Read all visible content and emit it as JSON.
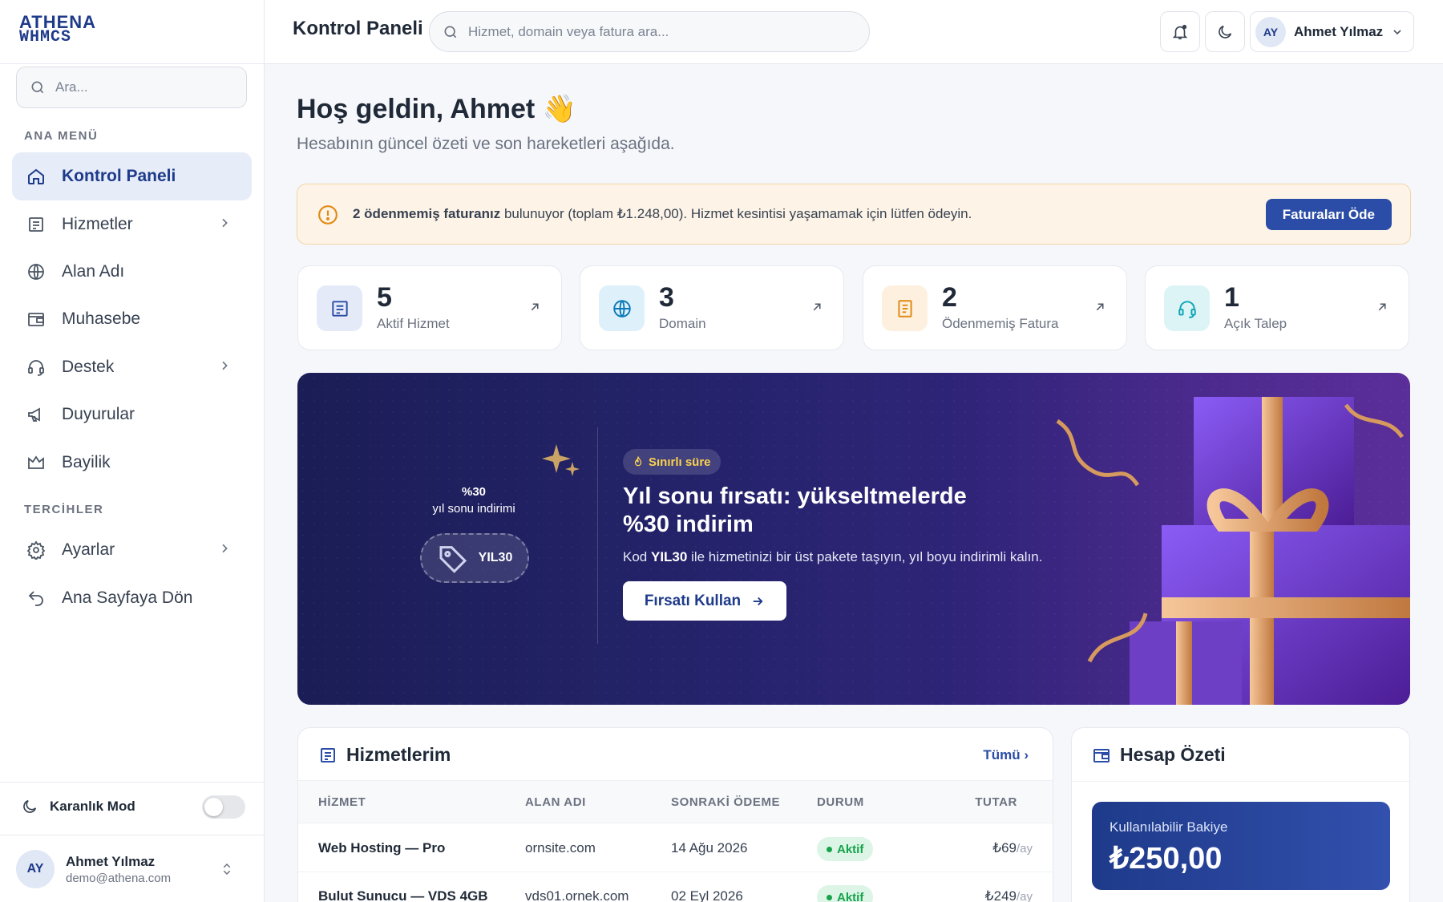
{
  "brand": {
    "logo_line1": "ATHENA",
    "logo_line2": "WHMCS"
  },
  "sidebar": {
    "search_placeholder": "Ara...",
    "section_main": "ANA MENÜ",
    "items": [
      {
        "label": "Kontrol Paneli",
        "icon": "home-icon",
        "active": true
      },
      {
        "label": "Hizmetler",
        "icon": "server-icon",
        "has_children": true
      },
      {
        "label": "Alan Adı",
        "icon": "globe-icon"
      },
      {
        "label": "Muhasebe",
        "icon": "wallet-icon"
      },
      {
        "label": "Destek",
        "icon": "headset-icon",
        "has_children": true
      },
      {
        "label": "Duyurular",
        "icon": "megaphone-icon"
      },
      {
        "label": "Bayilik",
        "icon": "crown-icon"
      }
    ],
    "section_prefs": "TERCİHLER",
    "pref_items": [
      {
        "label": "Ayarlar",
        "icon": "gear-icon",
        "has_children": true
      },
      {
        "label": "Ana Sayfaya Dön",
        "icon": "return-icon"
      }
    ],
    "dark_mode_label": "Karanlık Mod",
    "dark_mode_on": false,
    "user": {
      "initials": "AY",
      "name": "Ahmet Yılmaz",
      "email": "demo@athena.com"
    }
  },
  "topbar": {
    "title": "Kontrol Paneli",
    "search_placeholder": "Hizmet, domain veya fatura ara...",
    "user_initials": "AY",
    "user_name": "Ahmet Yılmaz"
  },
  "welcome": {
    "title": "Hoş geldin, Ahmet 👋",
    "subtitle": "Hesabının güncel özeti ve son hareketleri aşağıda."
  },
  "alert": {
    "bold": "2 ödenmemiş faturanız",
    "text": " bulunuyor (toplam ₺1.248,00). Hizmet kesintisi yaşamamak için lütfen ödeyin.",
    "button": "Faturaları Öde"
  },
  "stats": [
    {
      "value": "5",
      "label": "Aktif Hizmet",
      "icon": "server-icon",
      "color": "#2c4da7",
      "bg": "#e4eaf7"
    },
    {
      "value": "3",
      "label": "Domain",
      "icon": "globe-icon",
      "color": "#0b7ab8",
      "bg": "#def0fa"
    },
    {
      "value": "2",
      "label": "Ödenmemiş Fatura",
      "icon": "invoice-icon",
      "color": "#e08a14",
      "bg": "#fdf0de"
    },
    {
      "value": "1",
      "label": "Açık Talep",
      "icon": "headset-icon",
      "color": "#0ea5b7",
      "bg": "#dcf4f6"
    }
  ],
  "promo": {
    "discount": "%30",
    "discount_label": "yıl sonu indirimi",
    "code": "YIL30",
    "badge": "Sınırlı süre",
    "title": "Yıl sonu fırsatı: yükseltmelerde %30 indirim",
    "desc_prefix": "Kod ",
    "desc_code": "YIL30",
    "desc_suffix": " ile hizmetinizi bir üst pakete taşıyın, yıl boyu indirimli kalın.",
    "button": "Fırsatı Kullan"
  },
  "services": {
    "title": "Hizmetlerim",
    "all_link": "Tümü",
    "columns": [
      "HİZMET",
      "ALAN ADI",
      "SONRAKİ ÖDEME",
      "DURUM",
      "TUTAR"
    ],
    "rows": [
      {
        "name": "Web Hosting — Pro",
        "domain": "ornsite.com",
        "next": "14 Ağu 2026",
        "status": "Aktif",
        "amount": "₺69",
        "period": "/ay"
      },
      {
        "name": "Bulut Sunucu — VDS 4GB",
        "domain": "vds01.ornek.com",
        "next": "02 Eyl 2026",
        "status": "Aktif",
        "amount": "₺249",
        "period": "/ay"
      }
    ]
  },
  "account": {
    "title": "Hesap Özeti",
    "balance_label": "Kullanılabilir Bakiye",
    "balance": "₺250,00"
  }
}
